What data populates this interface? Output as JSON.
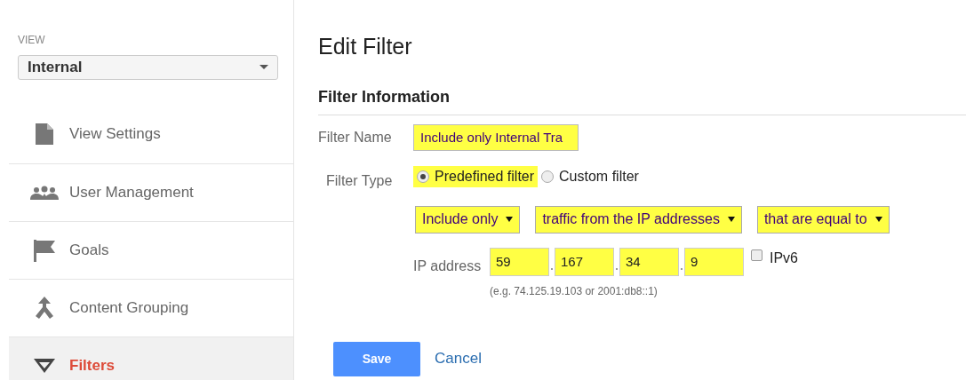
{
  "sidebar": {
    "view_label": "VIEW",
    "view_select": {
      "value": "Internal"
    },
    "items": [
      {
        "label": "View Settings",
        "selected": false
      },
      {
        "label": "User Management",
        "selected": false
      },
      {
        "label": "Goals",
        "selected": false
      },
      {
        "label": "Content Grouping",
        "selected": false
      },
      {
        "label": "Filters",
        "selected": true
      }
    ]
  },
  "page_title": "Edit Filter",
  "section_title": "Filter Information",
  "filter_name": {
    "label": "Filter Name",
    "value": "Include only Internal Tra",
    "highlighted": true
  },
  "filter_type": {
    "label": "Filter Type",
    "options": [
      {
        "label": "Predefined filter",
        "selected": true,
        "highlighted": true
      },
      {
        "label": "Custom filter",
        "selected": false,
        "highlighted": false
      }
    ]
  },
  "conditions": [
    {
      "value": "Include only",
      "highlighted": true
    },
    {
      "value": "traffic from the IP addresses",
      "highlighted": true
    },
    {
      "value": "that are equal to",
      "highlighted": true
    }
  ],
  "ip_address": {
    "label": "IP address",
    "octets": [
      {
        "value": "59",
        "highlighted": true
      },
      {
        "value": "167",
        "highlighted": true
      },
      {
        "value": "34",
        "highlighted": true
      },
      {
        "value": "9",
        "highlighted": true
      }
    ],
    "ipv6": {
      "label": "IPv6",
      "checked": false
    },
    "hint": "(e.g. 74.125.19.103 or 2001:db8::1)"
  },
  "buttons": [
    {
      "kind": "primary",
      "label": "Save"
    },
    {
      "kind": "link",
      "label": "Cancel"
    }
  ]
}
